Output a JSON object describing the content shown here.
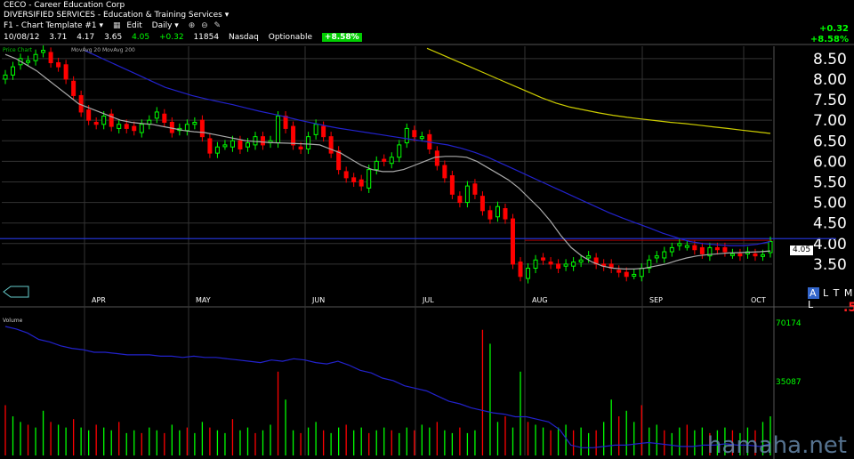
{
  "header": {
    "symbol": "CECO",
    "separator": "-",
    "company": "Career Education Corp",
    "industry": "DIVERSIFIED SERVICES - Education & Training Services",
    "template": "F1 - Chart Template #1",
    "edit_label": "Edit",
    "period": "Daily",
    "date": "10/08/12",
    "open": "3.71",
    "high": "4.17",
    "low": "3.65",
    "close": "4.05",
    "change": "+0.32",
    "volume": "11854",
    "exchange": "Nasdaq",
    "optionable": "Optionable",
    "pct_change": "+8.58%",
    "right_change": "+0.32",
    "right_pct": "+8.58%"
  },
  "legend": {
    "price_label": "Price Chart",
    "ma20": "MovAvg 20",
    "ma200": "MovAvg 200",
    "volume_label": "Volume"
  },
  "price_tag": "4.05",
  "altml": [
    "A",
    "L",
    "T",
    "M",
    "L"
  ],
  "five": ".5",
  "watermark": "hamaha.net",
  "colors": {
    "up": "#00ff00",
    "down": "#ff0000",
    "ma20": "#aaaaaa",
    "ma50": "#2222cc",
    "ma200": "#cccc00",
    "grid": "#333333",
    "axis": "#ffffff"
  },
  "chart_data": {
    "type": "candlestick",
    "price_axis": {
      "min": 3.0,
      "max": 8.8,
      "ticks": [
        "8.50",
        "8.00",
        "7.50",
        "7.00",
        "6.50",
        "6.00",
        "5.50",
        "5.00",
        "4.50",
        "4.00",
        "3.50"
      ]
    },
    "months": [
      "APR",
      "MAY",
      "JUN",
      "JUL",
      "AUG",
      "SEP",
      "OCT"
    ],
    "volume_axis": {
      "ticks": [
        "70174",
        "35087"
      ]
    },
    "closes": [
      8.1,
      8.3,
      8.5,
      8.45,
      8.6,
      8.7,
      8.4,
      8.3,
      8.0,
      7.6,
      7.2,
      7.0,
      6.9,
      7.1,
      6.85,
      6.9,
      6.8,
      6.75,
      6.9,
      7.0,
      7.2,
      6.95,
      6.7,
      6.8,
      6.9,
      6.95,
      6.6,
      6.2,
      6.35,
      6.4,
      6.5,
      6.3,
      6.45,
      6.6,
      6.4,
      6.5,
      7.1,
      6.8,
      6.4,
      6.3,
      6.6,
      6.9,
      6.6,
      6.2,
      5.8,
      5.6,
      5.5,
      5.4,
      5.8,
      6.0,
      6.0,
      6.1,
      6.4,
      6.8,
      6.6,
      6.6,
      6.3,
      5.9,
      5.6,
      5.2,
      5.0,
      5.4,
      5.2,
      4.8,
      4.6,
      4.9,
      4.6,
      3.5,
      3.2,
      3.4,
      3.6,
      3.6,
      3.5,
      3.4,
      3.5,
      3.55,
      3.6,
      3.7,
      3.5,
      3.45,
      3.4,
      3.3,
      3.2,
      3.25,
      3.4,
      3.6,
      3.7,
      3.8,
      3.9,
      4.0,
      3.95,
      3.85,
      3.75,
      3.9,
      3.85,
      3.8,
      3.75,
      3.7,
      3.8,
      3.7,
      3.73,
      4.05
    ],
    "ma20": [
      8.6,
      8.5,
      8.35,
      8.2,
      8.0,
      7.8,
      7.6,
      7.4,
      7.3,
      7.2,
      7.1,
      7.0,
      6.95,
      6.92,
      6.9,
      6.85,
      6.8,
      6.75,
      6.72,
      6.7,
      6.65,
      6.6,
      6.55,
      6.5,
      6.48,
      6.46,
      6.45,
      6.44,
      6.43,
      6.42,
      6.4,
      6.3,
      6.2,
      6.05,
      5.9,
      5.8,
      5.75,
      5.75,
      5.8,
      5.9,
      6.0,
      6.1,
      6.12,
      6.12,
      6.1,
      6.0,
      5.85,
      5.7,
      5.55,
      5.35,
      5.1,
      4.85,
      4.55,
      4.2,
      3.9,
      3.7,
      3.55,
      3.45,
      3.4,
      3.38,
      3.38,
      3.4,
      3.45,
      3.5,
      3.58,
      3.65,
      3.7,
      3.73,
      3.75,
      3.77,
      3.78,
      3.79,
      3.8,
      3.82
    ],
    "ma50": [
      8.7,
      8.55,
      8.4,
      8.25,
      8.1,
      7.95,
      7.8,
      7.7,
      7.6,
      7.52,
      7.45,
      7.38,
      7.3,
      7.22,
      7.15,
      7.08,
      7.0,
      6.93,
      6.86,
      6.8,
      6.75,
      6.7,
      6.65,
      6.6,
      6.55,
      6.5,
      6.45,
      6.4,
      6.32,
      6.22,
      6.1,
      5.95,
      5.8,
      5.65,
      5.5,
      5.35,
      5.2,
      5.05,
      4.9,
      4.75,
      4.62,
      4.5,
      4.38,
      4.25,
      4.15,
      4.05,
      4.0,
      3.97,
      3.95,
      3.95,
      3.98,
      4.05
    ],
    "ma200": [
      8.75,
      8.6,
      8.45,
      8.3,
      8.15,
      8.0,
      7.85,
      7.7,
      7.55,
      7.42,
      7.32,
      7.25,
      7.18,
      7.12,
      7.07,
      7.03,
      6.99,
      6.95,
      6.92,
      6.88,
      6.84,
      6.8,
      6.76,
      6.72,
      6.68
    ],
    "volume": [
      18,
      14,
      12,
      11,
      10,
      16,
      12,
      11,
      10,
      13,
      10,
      9,
      11,
      10,
      9,
      12,
      8,
      9,
      8,
      10,
      9,
      8,
      11,
      9,
      10,
      8,
      12,
      10,
      9,
      8,
      13,
      9,
      10,
      8,
      9,
      11,
      30,
      20,
      9,
      8,
      10,
      12,
      9,
      8,
      10,
      11,
      9,
      10,
      8,
      9,
      10,
      9,
      8,
      10,
      9,
      11,
      10,
      12,
      9,
      8,
      10,
      8,
      9,
      45,
      40,
      12,
      14,
      10,
      30,
      12,
      11,
      10,
      9,
      10,
      11,
      9,
      10,
      8,
      9,
      12,
      20,
      14,
      16,
      12,
      18,
      10,
      11,
      9,
      8,
      10,
      11,
      9,
      10,
      8,
      9,
      10,
      9,
      8,
      10,
      9,
      12,
      14
    ],
    "volume_ma": [
      100,
      98,
      95,
      90,
      88,
      85,
      83,
      82,
      80,
      80,
      79,
      78,
      78,
      78,
      77,
      77,
      76,
      77,
      76,
      76,
      75,
      74,
      73,
      72,
      74,
      73,
      75,
      74,
      72,
      71,
      73,
      70,
      66,
      64,
      60,
      58,
      54,
      52,
      50,
      46,
      42,
      40,
      37,
      35,
      33,
      32,
      30,
      30,
      28,
      26,
      20,
      8,
      6,
      6,
      7,
      8,
      8,
      9,
      10,
      9,
      8,
      7,
      7,
      8,
      8,
      9,
      8,
      8,
      7,
      9
    ]
  }
}
